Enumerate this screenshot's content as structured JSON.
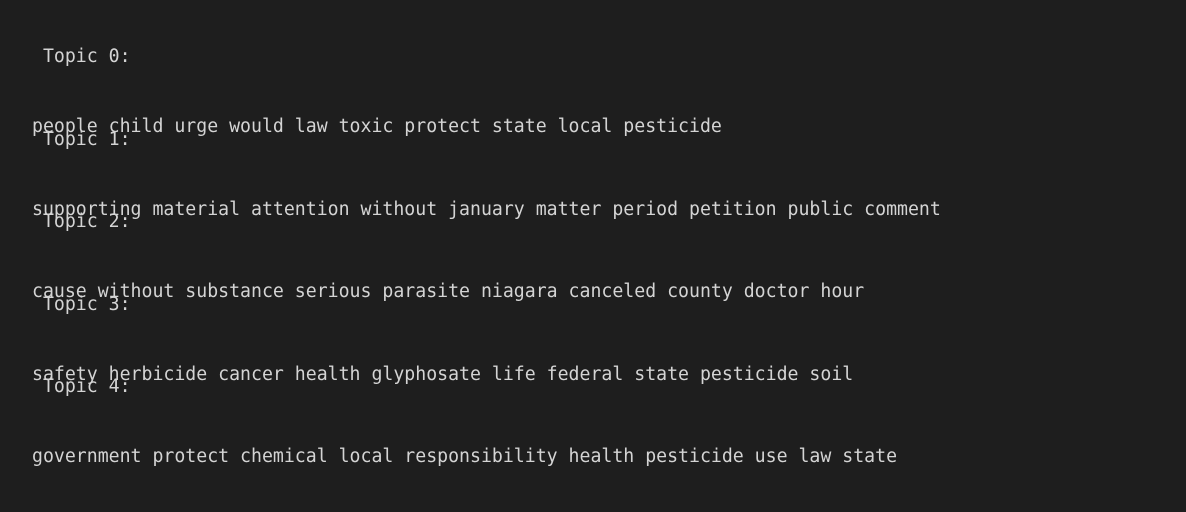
{
  "topics": [
    {
      "heading": " Topic 0:",
      "words": "people child urge would law toxic protect state local pesticide"
    },
    {
      "heading": " Topic 1:",
      "words": "supporting material attention without january matter period petition public comment"
    },
    {
      "heading": " Topic 2:",
      "words": "cause without substance serious parasite niagara canceled county doctor hour"
    },
    {
      "heading": " Topic 3:",
      "words": "safety herbicide cancer health glyphosate life federal state pesticide soil"
    },
    {
      "heading": " Topic 4:",
      "words": "government protect chemical local responsibility health pesticide use law state"
    }
  ]
}
